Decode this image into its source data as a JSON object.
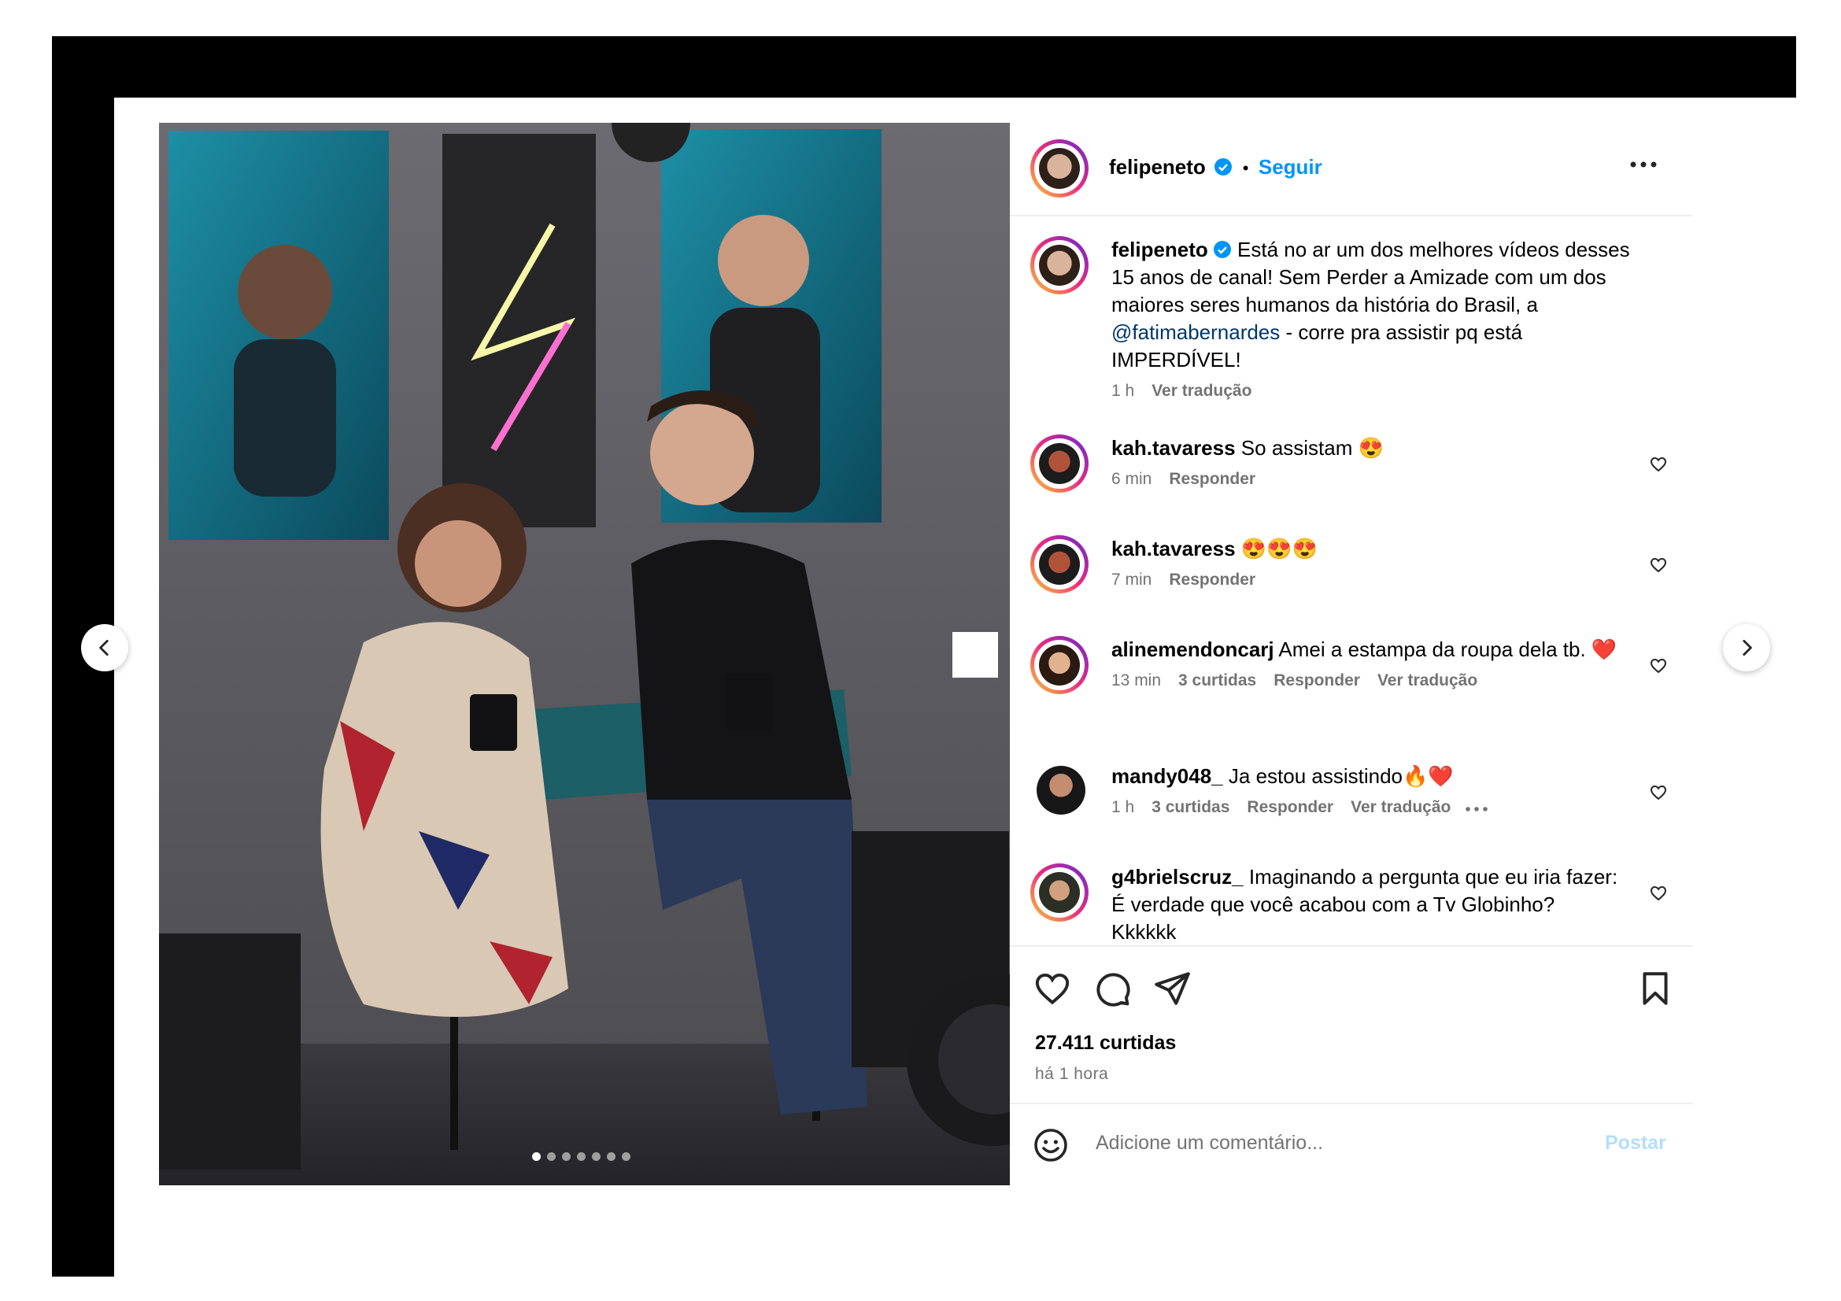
{
  "post": {
    "username": "felipeneto",
    "follow_label": "Seguir",
    "separator": "•",
    "caption_text": "Está no ar um dos melhores vídeos desses 15 anos de canal! Sem Perder a Amizade com um dos maiores seres humanos da história do Brasil, a",
    "caption_mention": "@fatimabernardes",
    "caption_end": "- corre pra assistir pq está IMPERDÍVEL!",
    "caption_time": "1 h",
    "caption_translate": "Ver tradução",
    "likes": "27.411 curtidas",
    "time_ago": "há 1 hora",
    "carousel_total": 7,
    "carousel_active": 0
  },
  "comments": [
    {
      "username": "kah.tavaress",
      "text": "So assistam 😍",
      "time": "6 min",
      "likes": "",
      "reply": "Responder",
      "translate": ""
    },
    {
      "username": "kah.tavaress",
      "text": "😍😍😍",
      "time": "7 min",
      "likes": "",
      "reply": "Responder",
      "translate": ""
    },
    {
      "username": "alinemendoncarj",
      "text": "Amei a estampa da roupa dela tb. ❤️",
      "time": "13 min",
      "likes": "3 curtidas",
      "reply": "Responder",
      "translate": "Ver tradução"
    },
    {
      "username": "mandy048_",
      "text": "Ja estou assistindo🔥❤️",
      "time": "1 h",
      "likes": "3 curtidas",
      "reply": "Responder",
      "translate": "Ver tradução"
    },
    {
      "username": "g4brielscruz_",
      "text": "Imaginando a pergunta que eu iria fazer: É verdade que você acabou com a Tv Globinho? Kkkkkk",
      "time": "",
      "likes": "",
      "reply": "",
      "translate": ""
    }
  ],
  "composer": {
    "placeholder": "Adicione um comentário...",
    "post_label": "Postar"
  },
  "icons": {
    "more": "more-options-icon",
    "like": "heart-icon",
    "comment": "comment-icon",
    "share": "share-icon",
    "save": "bookmark-icon",
    "emoji": "emoji-icon",
    "prev": "chevron-left-icon",
    "next": "chevron-right-icon"
  },
  "colors": {
    "accent": "#0095f6",
    "mention": "#00376b",
    "muted": "#737373",
    "post_disabled": "#b2dffc"
  }
}
